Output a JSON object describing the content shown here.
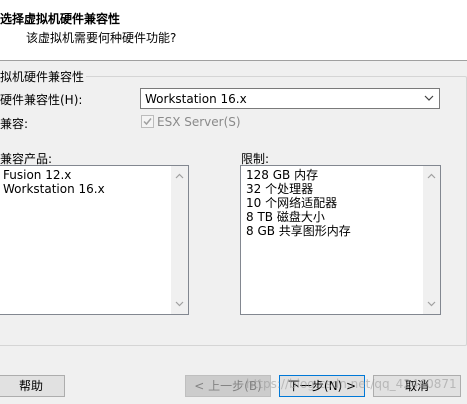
{
  "header": {
    "title": "选择虚拟机硬件兼容性",
    "subtitle": "该虚拟机需要何种硬件功能?"
  },
  "group": {
    "label": "拟机硬件兼容性",
    "compat_label": "硬件兼容性(H):",
    "compat_value": "Workstation 16.x",
    "compat2_label": "兼容:",
    "esx_label": "ESX Server(S)",
    "esx_checked": true,
    "esx_disabled": true,
    "products_label": "兼容产品:",
    "products": [
      "Fusion 12.x",
      "Workstation 16.x"
    ],
    "limits_label": "限制:",
    "limits": [
      "128 GB 内存",
      "32 个处理器",
      "10 个网络适配器",
      "8 TB 磁盘大小",
      "8 GB 共享图形内存"
    ]
  },
  "buttons": {
    "help": "帮助",
    "back": "< 上一步(B)",
    "next": "下一步(N) >",
    "cancel": "取消"
  },
  "watermark": "https://blog.csdn.net/qq_42440871",
  "colors": {
    "accent": "#0078d7",
    "disabled_text": "#838383"
  }
}
